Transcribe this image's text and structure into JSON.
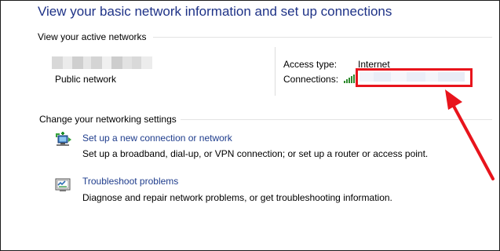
{
  "header": {
    "title": "View your basic network information and set up connections"
  },
  "active_networks": {
    "heading": "View your active networks",
    "network_category": "Public network",
    "access_type_label": "Access type:",
    "access_type_value": "Internet",
    "connections_label": "Connections:"
  },
  "settings": {
    "heading": "Change your networking settings",
    "tasks": [
      {
        "title": "Set up a new connection or network",
        "description": "Set up a broadband, dial-up, or VPN connection; or set up a router or access point.",
        "icon": "network-connection-icon"
      },
      {
        "title": "Troubleshoot problems",
        "description": "Diagnose and repair network problems, or get troubleshooting information.",
        "icon": "troubleshoot-icon"
      }
    ]
  },
  "colors": {
    "title": "#1e3287",
    "link": "#1e3c8c",
    "annotation": "#e8141c",
    "signal": "#2d8a2d"
  }
}
